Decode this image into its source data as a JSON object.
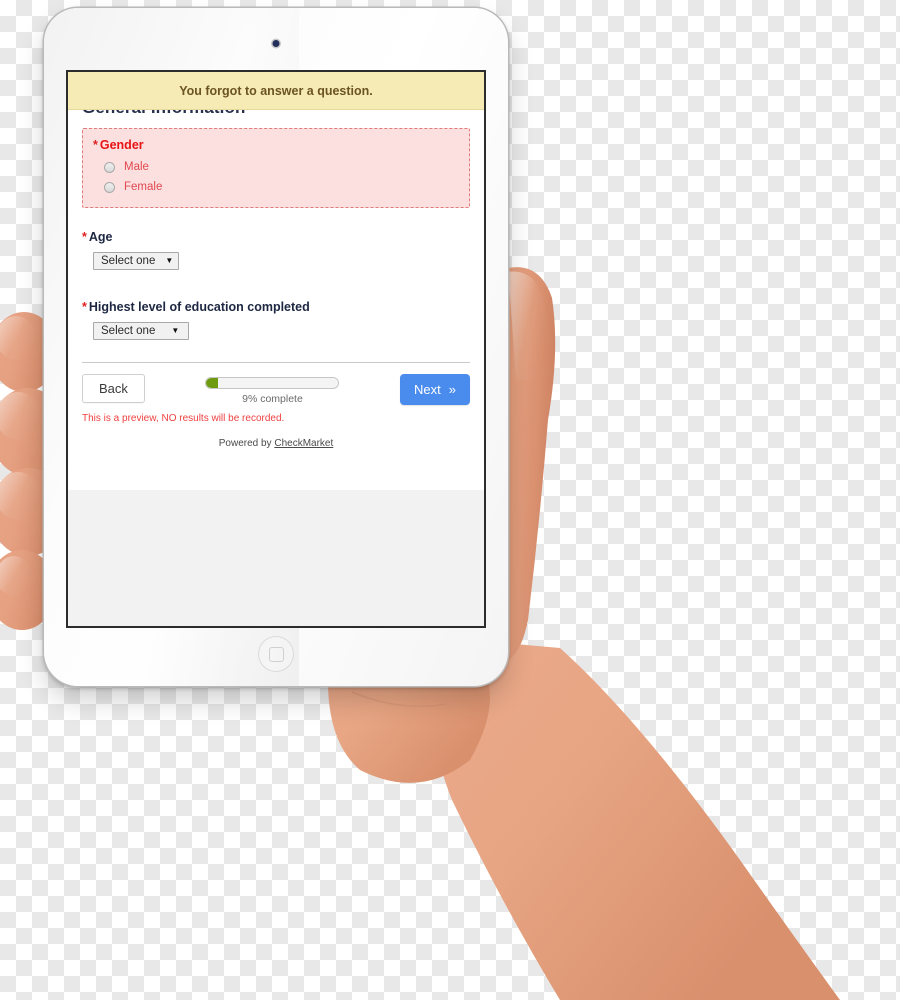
{
  "alert": {
    "message": "You forgot to answer a question."
  },
  "survey": {
    "heading": "General Information",
    "required_marker": "*",
    "questions": [
      {
        "id": "gender",
        "label": "Gender",
        "required": true,
        "state": "error",
        "type": "radio",
        "options": [
          {
            "label": "Male",
            "selected": false
          },
          {
            "label": "Female",
            "selected": false
          }
        ]
      },
      {
        "id": "age",
        "label": "Age",
        "required": true,
        "state": "normal",
        "type": "select",
        "value": "Select one",
        "caret": "▼"
      },
      {
        "id": "education",
        "label": "Highest level of education completed",
        "required": true,
        "state": "normal",
        "type": "select",
        "value": "Select one",
        "caret": "▼"
      }
    ]
  },
  "footer": {
    "back_label": "Back",
    "next_label": "Next",
    "next_chevron": "»",
    "progress_percent": 9,
    "progress_text": "9% complete",
    "preview_notice": "This is a preview, NO results will be recorded.",
    "powered_by_prefix": "Powered by ",
    "powered_by_brand": "CheckMarket"
  },
  "device": {
    "type": "tablet",
    "camera": "front-camera-dot",
    "home_button": "home-button"
  },
  "colors": {
    "alert_background": "#f7ebb5",
    "alert_text": "#6b5420",
    "error_background": "#fce0e0",
    "error_border": "#e07b7b",
    "error_text": "#e81313",
    "option_text": "#e0484f",
    "label_text": "#1d2742",
    "next_button": "#4a8ced",
    "progress_fill": "#6f9b10",
    "preview_notice": "#ef4040"
  }
}
